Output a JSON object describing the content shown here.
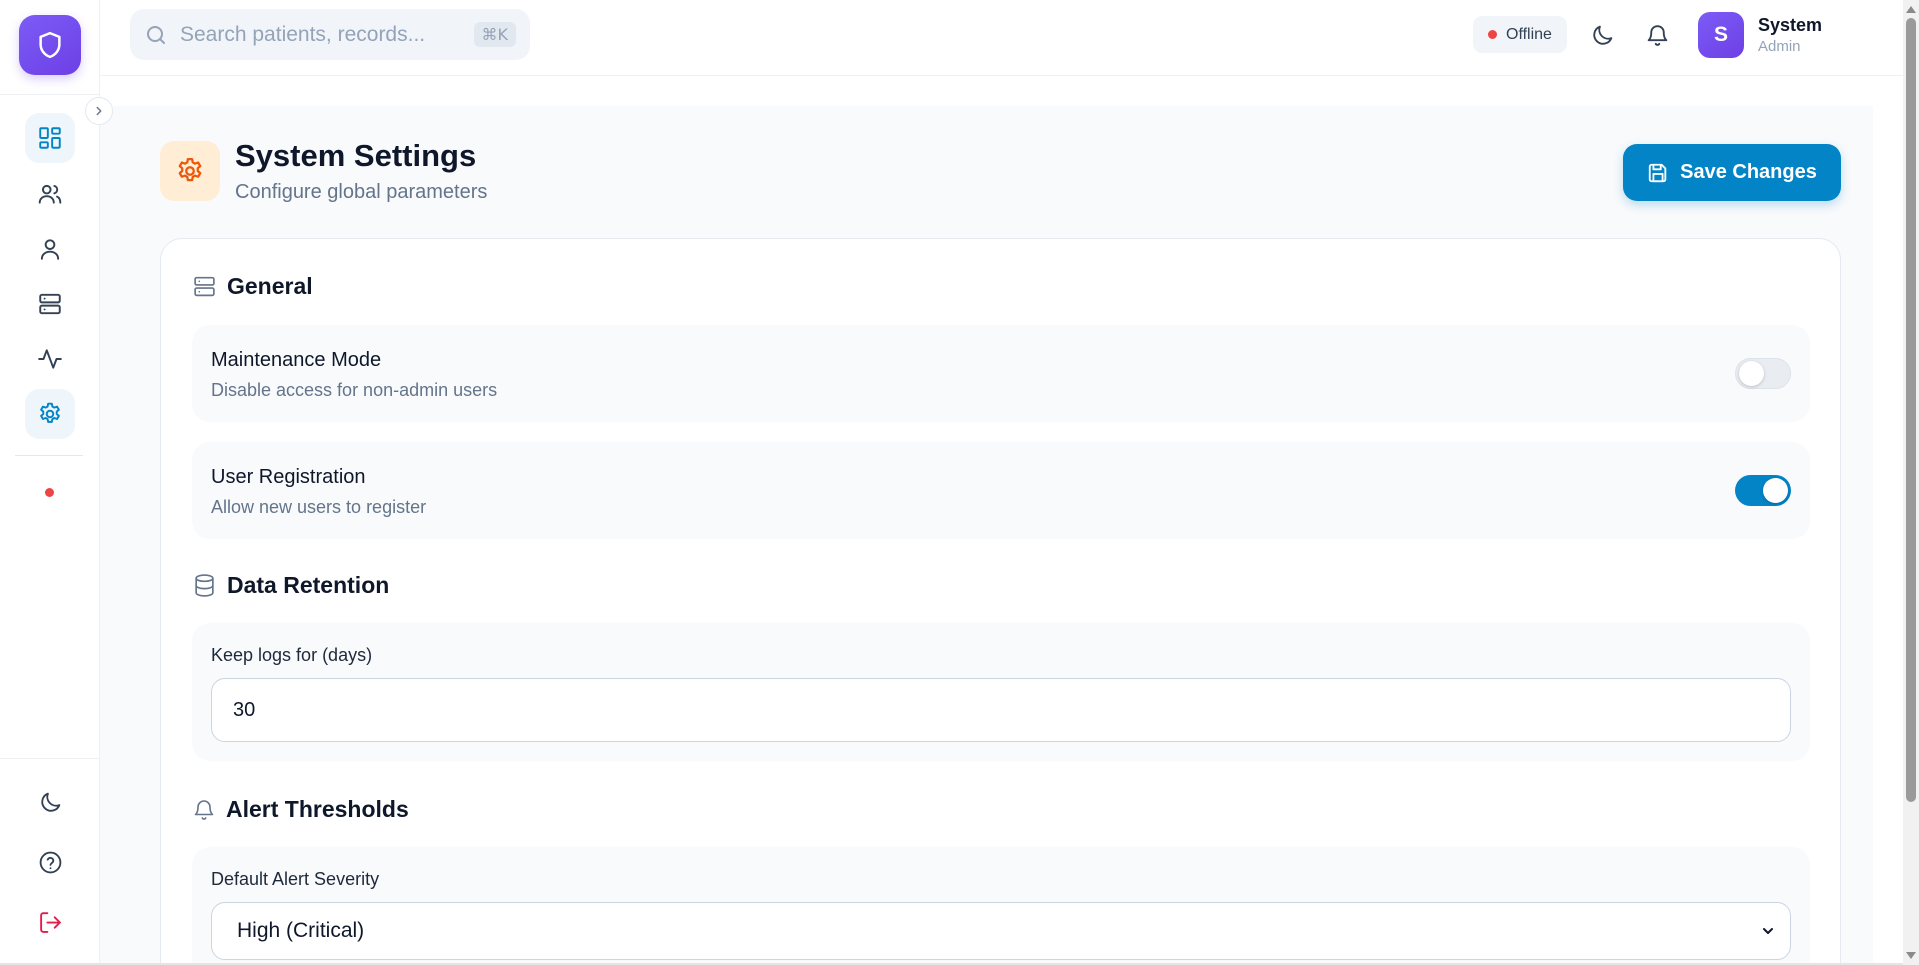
{
  "search": {
    "placeholder": "Search patients, records...",
    "shortcut": "⌘K"
  },
  "header": {
    "status": "Offline",
    "user": {
      "initial": "S",
      "name": "System",
      "role": "Admin"
    }
  },
  "page": {
    "title": "System Settings",
    "subtitle": "Configure global parameters",
    "save_label": "Save Changes"
  },
  "sections": {
    "general": {
      "title": "General",
      "maintenance": {
        "title": "Maintenance Mode",
        "desc": "Disable access for non-admin users",
        "enabled": false
      },
      "registration": {
        "title": "User Registration",
        "desc": "Allow new users to register",
        "enabled": true
      }
    },
    "retention": {
      "title": "Data Retention",
      "label": "Keep logs for (days)",
      "value": "30"
    },
    "alerts": {
      "title": "Alert Thresholds",
      "label": "Default Alert Severity",
      "selected": "High (Critical)"
    }
  },
  "colors": {
    "brand": "#6d3fe6",
    "primary": "#0284c7",
    "danger": "#ef4444",
    "settings_accent": "#ea580c"
  }
}
